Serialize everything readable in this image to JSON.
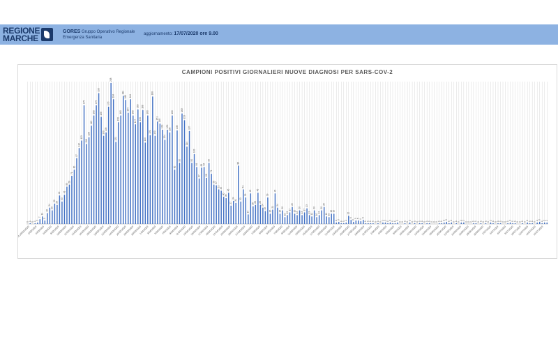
{
  "header": {
    "logo_line1": "REGIONE",
    "logo_line2": "MARCHE",
    "org_name": "GORES",
    "org_desc1": "Gruppo Operativo Regionale",
    "org_desc2": "Emergenza Sanitaria",
    "update_label": "aggiornamento:",
    "update_value": "17/07/2020 ore 9.00"
  },
  "colors": {
    "header_bg": "#8db2e2",
    "bar": "#4472c4",
    "grid": "#d9d9d9",
    "text": "#595959"
  },
  "chart_data": {
    "type": "bar",
    "title": "CAMPIONI POSITIVI GIORNALIERI NUOVE DIAGNOSI PER SARS-COV-2",
    "xlabel": "",
    "ylabel": "",
    "ylim": [
      0,
      210
    ],
    "grid": true,
    "legend": "none",
    "x_tick_labels": [
      "DA 3/4-1 A 29/02/2020",
      "2/03/2020",
      "4/03/2020",
      "6/03/2020",
      "8/03/2020",
      "10/03/2020",
      "12/03/2020",
      "14/03/2020",
      "16/03/2020",
      "18/03/2020",
      "20/03/2020",
      "22/03/2020",
      "24/03/2020",
      "26/03/2020",
      "28/03/2020",
      "30/03/2020",
      "1/04/2020",
      "3/04/2020",
      "5/04/2020",
      "7/04/2020",
      "9/04/2020",
      "11/04/2020",
      "13/04/2020",
      "15/04/2020",
      "17/04/2020",
      "19/04/2020",
      "21/04/2020",
      "23/04/2020",
      "25/04/2020",
      "27/04/2020",
      "29/04/2020",
      "1/05/2020",
      "3/05/2020",
      "5/05/2020",
      "7/05/2020",
      "9/05/2020",
      "11/05/2020",
      "13/05/2020",
      "15/05/2020",
      "17/05/2020",
      "19/05/2020",
      "21/05/2020",
      "23/05/2020",
      "25/05/2020",
      "27/05/2020",
      "29/05/2020",
      "31/05/2020",
      "2/06/2020",
      "4/06/2020",
      "6/06/2020",
      "8/06/2020",
      "10/06/2020",
      "12/06/2020",
      "14/06/2020",
      "16/06/2020",
      "18/06/2020",
      "20/06/2020",
      "22/06/2020",
      "24/06/2020",
      "26/06/2020",
      "28/06/2020",
      "30/06/2020",
      "2/07/2020",
      "4/07/2020",
      "6/07/2020",
      "8/07/2020",
      "10/07/2020",
      "12/07/2020",
      "14/07/2020",
      "16/07/2020"
    ],
    "values": [
      0,
      1,
      0,
      1,
      2,
      7,
      11,
      5,
      16,
      24,
      20,
      30,
      28,
      42,
      33,
      43,
      55,
      58,
      71,
      80,
      97,
      112,
      123,
      175,
      118,
      128,
      145,
      160,
      175,
      193,
      158,
      130,
      135,
      173,
      208,
      184,
      121,
      150,
      160,
      189,
      183,
      164,
      184,
      160,
      147,
      169,
      150,
      168,
      120,
      160,
      131,
      188,
      130,
      151,
      148,
      139,
      124,
      139,
      135,
      160,
      80,
      138,
      90,
      163,
      153,
      114,
      137,
      90,
      103,
      84,
      67,
      83,
      84,
      68,
      90,
      74,
      58,
      57,
      51,
      49,
      40,
      38,
      46,
      27,
      34,
      31,
      86,
      33,
      51,
      39,
      14,
      45,
      26,
      28,
      46,
      28,
      24,
      19,
      39,
      15,
      21,
      45,
      24,
      15,
      20,
      10,
      13,
      17,
      25,
      15,
      13,
      20,
      13,
      17,
      23,
      13,
      11,
      20,
      10,
      13,
      20,
      25,
      11,
      10,
      15,
      15,
      2,
      3,
      1,
      1,
      2,
      12,
      6,
      3,
      5,
      5,
      4,
      6,
      1,
      1,
      1,
      1,
      0,
      1,
      0,
      2,
      2,
      1,
      2,
      1,
      1,
      2,
      0,
      0,
      1,
      0,
      2,
      0,
      1,
      0,
      1,
      1,
      0,
      1,
      1,
      0,
      0,
      0,
      1,
      1,
      2,
      3,
      1,
      2,
      0,
      1,
      0,
      2,
      2,
      0,
      0,
      0,
      1,
      1,
      0,
      1,
      0,
      1,
      0,
      2,
      1,
      0,
      1,
      1,
      0,
      0,
      1,
      2,
      1,
      1,
      0,
      0,
      1,
      0,
      2,
      1,
      1,
      0,
      2,
      3,
      1,
      2,
      2
    ]
  }
}
